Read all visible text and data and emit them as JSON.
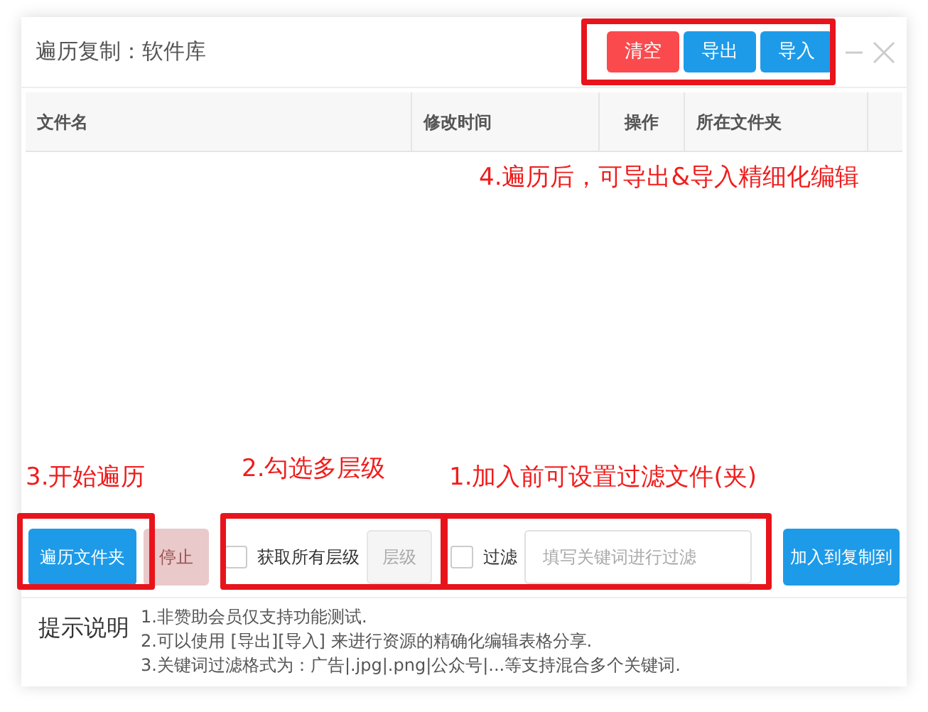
{
  "window": {
    "title": "遍历复制：软件库"
  },
  "header_buttons": [
    {
      "label": "清空",
      "kind": "danger"
    },
    {
      "label": "导出",
      "kind": "primary"
    },
    {
      "label": "导入",
      "kind": "primary"
    }
  ],
  "table": {
    "columns": [
      "文件名",
      "修改时间",
      "操作",
      "所在文件夹"
    ]
  },
  "toolbar": {
    "scan_button": {
      "label": "遍历文件夹"
    },
    "stop_button": {
      "label": "停止",
      "disabled": true
    },
    "all_levels": {
      "label": "获取所有层级",
      "checked": false
    },
    "level_button": {
      "label": "层级",
      "disabled": true
    },
    "filter": {
      "label": "过滤",
      "checked": false
    },
    "filter_field": {
      "placeholder": "填写关键词进行过滤"
    },
    "add_button": {
      "label": "加入到复制到"
    }
  },
  "notes": {
    "title": "提示说明",
    "lines": [
      "1.非赞助会员仅支持功能测试.",
      "2.可以使用 [导出][导入] 来进行资源的精确化编辑表格分享.",
      "3.关键词过滤格式为：广告|.jpg|.png|公众号|...等支持混合多个关键词."
    ]
  },
  "annotations": [
    "4.遍历后，可导出&导入精细化编辑",
    "3.开始遍历",
    "2.勾选多层级",
    "1.加入前可设置过滤文件(夹)"
  ]
}
